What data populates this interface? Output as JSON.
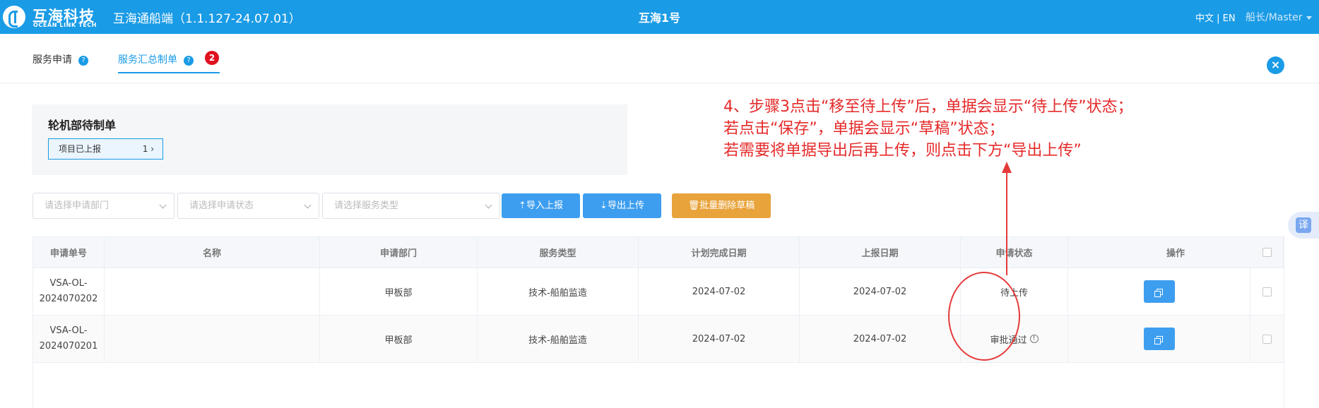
{
  "header": {
    "logo_cn": "互海科技",
    "logo_en": "OCEAN LINK TECH",
    "app_title": "互海通船端（1.1.127-24.07.01）",
    "ship_name": "互海1号",
    "lang": "中文 | EN",
    "user": "船长/Master",
    "bg_color": "#1a9be6"
  },
  "tabs": [
    {
      "label": "服务申请",
      "active": false
    },
    {
      "label": "服务汇总制单",
      "active": true,
      "badge": "2"
    }
  ],
  "help_icon": "?",
  "close_icon": "×",
  "summary": {
    "title": "轮机部待制单",
    "chip_label": "项目已上报",
    "chip_count": "1",
    "chevron": "›"
  },
  "filters": {
    "dept_placeholder": "请选择申请部门",
    "status_placeholder": "请选择申请状态",
    "service_placeholder": "请选择服务类型"
  },
  "toolbar": {
    "import_label": "⇡导入上报",
    "export_label": "⇣导出上传",
    "batch_delete_label": "批量删除草稿"
  },
  "table": {
    "headers": [
      "申请单号",
      "名称",
      "申请部门",
      "服务类型",
      "计划完成日期",
      "上报日期",
      "申请状态",
      "操作"
    ],
    "rows": [
      {
        "no": "VSA-OL-2024070202",
        "name": "",
        "dept": "甲板部",
        "service": "技术-船舶监造",
        "plan_date": "2024-07-02",
        "report_date": "2024-07-02",
        "status": "待上传"
      },
      {
        "no": "VSA-OL-2024070201",
        "name": "",
        "dept": "甲板部",
        "service": "技术-船舶监造",
        "plan_date": "2024-07-02",
        "report_date": "2024-07-02",
        "status": "审批通过"
      }
    ]
  },
  "annotation": {
    "line1": "4、步骤3点击“移至待上传”后，单据会显示“待上传”状态；",
    "line2": "若点击“保存”，单据会显示“草稿”状态；",
    "line3": "若需要将单据导出后再上传，则点击下方“导出上传”",
    "color": "#e52a2a"
  },
  "translate_label": "译"
}
